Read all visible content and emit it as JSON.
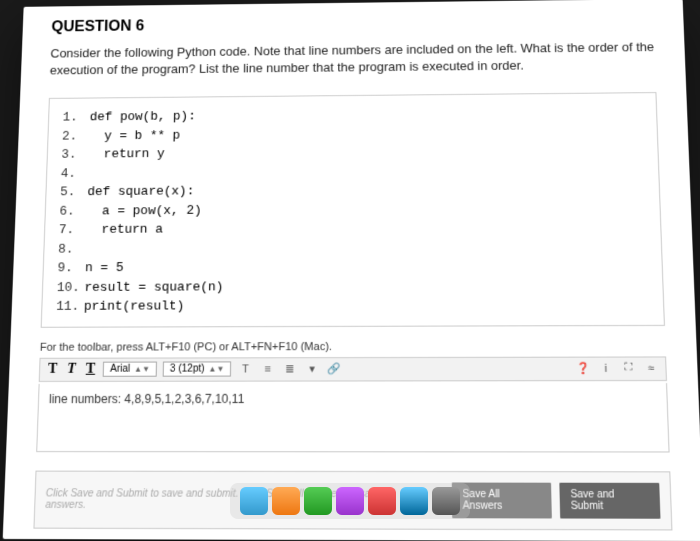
{
  "question": {
    "heading": "QUESTION 6",
    "prompt": "Consider the following Python code. Note that line numbers are included on the left. What is the order of the execution of the program? List the line number that the program is executed in order."
  },
  "code": [
    {
      "n": "1.",
      "t": "def pow(b, p):"
    },
    {
      "n": "2.",
      "t": "  y = b ** p"
    },
    {
      "n": "3.",
      "t": "  return y"
    },
    {
      "n": "4.",
      "t": ""
    },
    {
      "n": "5.",
      "t": "def square(x):"
    },
    {
      "n": "6.",
      "t": "  a = pow(x, 2)"
    },
    {
      "n": "7.",
      "t": "  return a"
    },
    {
      "n": "8.",
      "t": ""
    },
    {
      "n": "9.",
      "t": "n = 5"
    },
    {
      "n": "10.",
      "t": "result = square(n)"
    },
    {
      "n": "11.",
      "t": "print(result)"
    }
  ],
  "editor": {
    "hint": "For the toolbar, press ALT+F10 (PC) or ALT+FN+F10 (Mac).",
    "bold": "T",
    "italic": "T",
    "underline": "T",
    "font": "Arial",
    "size": "3 (12pt)",
    "answer": "line numbers: 4,8,9,5,1,2,3,6,7,10,11"
  },
  "footer": {
    "note": "Click Save and Submit to save and submit. Click Save All Answers to save all answers.",
    "saveAll": "Save All Answers",
    "submit": "Save and Submit"
  }
}
